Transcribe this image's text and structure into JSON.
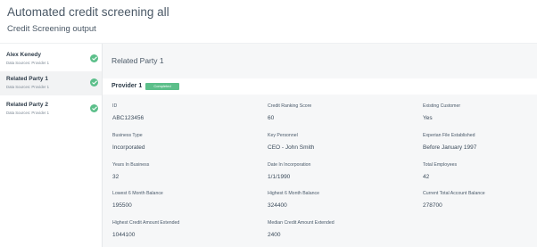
{
  "page": {
    "title": "Automated credit screening all",
    "subtitle": "Credit Screening output"
  },
  "sidebar": {
    "items": [
      {
        "name": "Alex Kenedy",
        "source": "Data Sources: Provider 1"
      },
      {
        "name": "Related Party 1",
        "source": "Data Sources: Provider 1"
      },
      {
        "name": "Related Party 2",
        "source": "Data Sources: Provider 1"
      }
    ]
  },
  "main": {
    "title": "Related Party 1",
    "provider": "Provider 1",
    "status": "Completed",
    "fields": [
      {
        "label": "ID",
        "value": "ABC123456"
      },
      {
        "label": "Credit Ranking Score",
        "value": "60"
      },
      {
        "label": "Existing Customer",
        "value": "Yes"
      },
      {
        "label": "Business Type",
        "value": "Incorporated"
      },
      {
        "label": "Key Personnel",
        "value": "CEO - John Smith"
      },
      {
        "label": "Experian File Established",
        "value": "Before January 1997"
      },
      {
        "label": "Years In Business",
        "value": "32"
      },
      {
        "label": "Date In Incorporation",
        "value": "1/1/1990"
      },
      {
        "label": "Total Employees",
        "value": "42"
      },
      {
        "label": "Lowest 6 Month Balance",
        "value": "195500"
      },
      {
        "label": "Highest 6 Month Balance",
        "value": "324400"
      },
      {
        "label": "Current Total Account Balance",
        "value": "278700"
      },
      {
        "label": "Highest Credit Amount Extended",
        "value": "1044100"
      },
      {
        "label": "Median Credit Amount Extended",
        "value": "2400"
      }
    ]
  }
}
